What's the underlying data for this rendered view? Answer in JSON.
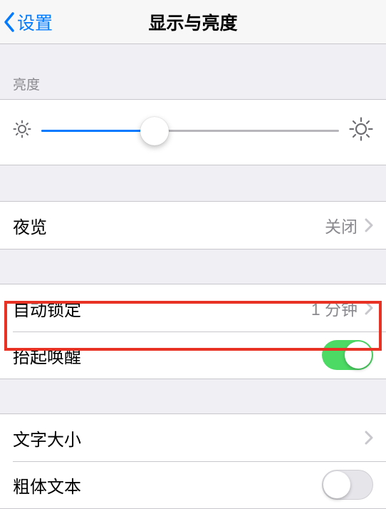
{
  "nav": {
    "back_label": "设置",
    "title": "显示与亮度"
  },
  "brightness": {
    "header": "亮度",
    "value_percent": 38
  },
  "night_shift": {
    "label": "夜览",
    "value": "关闭"
  },
  "auto_lock": {
    "label": "自动锁定",
    "value": "1 分钟"
  },
  "raise_to_wake": {
    "label": "抬起唤醒",
    "enabled": true
  },
  "text_size": {
    "label": "文字大小"
  },
  "bold_text": {
    "label": "粗体文本",
    "enabled": false
  }
}
